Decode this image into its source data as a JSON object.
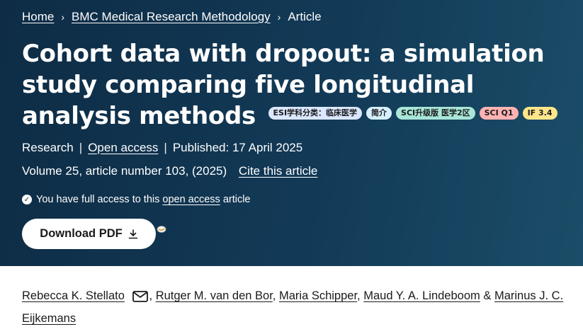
{
  "breadcrumb": {
    "items": [
      "Home",
      "BMC Medical Research Methodology",
      "Article"
    ],
    "separator": "›"
  },
  "article": {
    "title": "Cohort data with dropout: a simulation study comparing five longitudinal analysis methods",
    "badges": [
      {
        "label": "ESI学科分类：临床医学",
        "color": "#dbe7ff"
      },
      {
        "label": "简介",
        "color": "#d6f0ff"
      },
      {
        "label": "SCI升级版 医学2区",
        "color": "#a8e6d8"
      },
      {
        "label": "SCI Q1",
        "color": "#ffb3b3"
      },
      {
        "label": "IF 3.4",
        "color": "#fde68a"
      }
    ],
    "type": "Research",
    "access": "Open access",
    "published": "Published: 17 April 2025",
    "volume": "Volume 25, article number 103, (2025)",
    "cite_label": "Cite this article"
  },
  "access_notice": {
    "prefix": "You have full access to this",
    "link": "open access",
    "suffix": "article"
  },
  "download": {
    "label": "Download PDF"
  },
  "authors": {
    "list": [
      "Rebecca K. Stellato",
      "Rutger M. van den Bor",
      "Maria Schipper",
      "Maud Y. A. Lindeboom",
      "Marinus J. C. Eijkemans"
    ],
    "separators": [
      ",",
      ",",
      ",",
      "&"
    ],
    "mail_icon": "envelope-icon"
  },
  "colors": {
    "hero_bg": "#123a57",
    "text_on_hero": "#ffffff",
    "button_bg": "#ffffff"
  }
}
